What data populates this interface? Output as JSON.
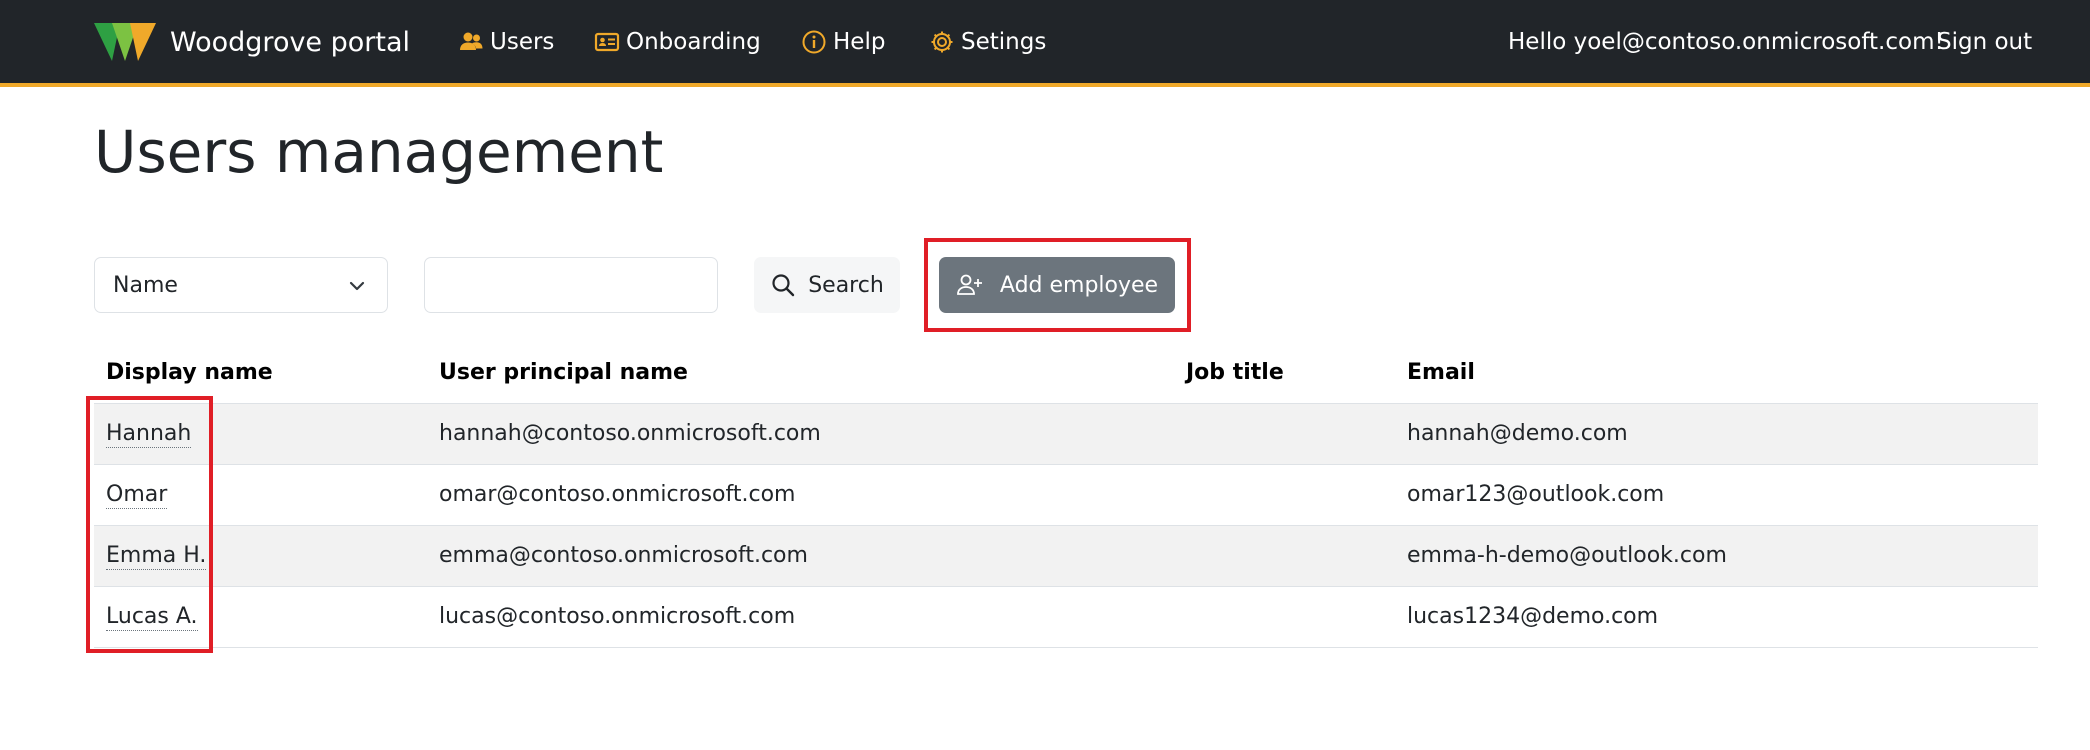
{
  "navbar": {
    "brand": "Woodgrove portal",
    "items": [
      {
        "label": "Users",
        "icon": "users-icon"
      },
      {
        "label": "Onboarding",
        "icon": "id-card-icon"
      },
      {
        "label": "Help",
        "icon": "info-icon"
      },
      {
        "label": "Setings",
        "icon": "gear-icon"
      }
    ],
    "greeting": "Hello yoel@contoso.onmicrosoft.com!",
    "signout": "Sign out"
  },
  "page": {
    "title": "Users management"
  },
  "toolbar": {
    "filter_selected": "Name",
    "search_value": "",
    "search_label": "Search",
    "add_label": "Add employee"
  },
  "table": {
    "headers": [
      "Display name",
      "User principal name",
      "Job title",
      "Email"
    ],
    "rows": [
      {
        "display_name": "Hannah",
        "upn": "hannah@contoso.onmicrosoft.com",
        "job_title": "",
        "email": "hannah@demo.com"
      },
      {
        "display_name": "Omar",
        "upn": "omar@contoso.onmicrosoft.com",
        "job_title": "",
        "email": "omar123@outlook.com"
      },
      {
        "display_name": "Emma H.",
        "upn": "emma@contoso.onmicrosoft.com",
        "job_title": "",
        "email": "emma-h-demo@outlook.com"
      },
      {
        "display_name": "Lucas A.",
        "upn": "lucas@contoso.onmicrosoft.com",
        "job_title": "",
        "email": "lucas1234@demo.com"
      }
    ]
  },
  "colors": {
    "navbar_bg": "#212529",
    "accent": "#f0a92a",
    "highlight": "#e01e26",
    "add_button": "#6c757d"
  }
}
